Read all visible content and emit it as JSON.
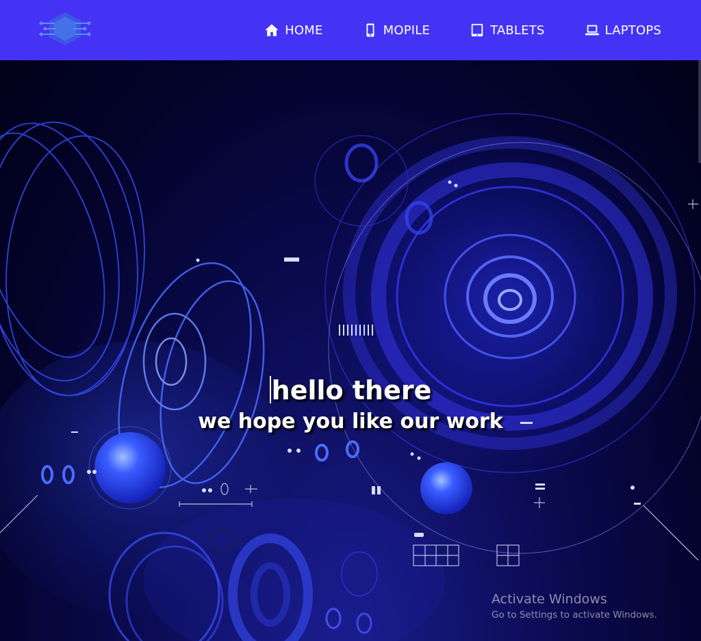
{
  "navbar": {
    "logo": {
      "icon": "circuit-hexagon-logo-icon"
    },
    "links": [
      {
        "label": "HOME",
        "icon": "home-icon"
      },
      {
        "label": "MOPILE",
        "icon": "mobile-phone-icon"
      },
      {
        "label": "TABLETS",
        "icon": "tablet-icon"
      },
      {
        "label": "LAPTOPS",
        "icon": "laptop-icon"
      }
    ],
    "background": "#4433f5"
  },
  "hero": {
    "title": "hello there",
    "subtitle": "we hope you like our work",
    "background_image": "abstract-blue-rings-tech-icon"
  },
  "watermark": {
    "title": "Activate Windows",
    "subtitle": "Go to Settings to activate Windows."
  },
  "colors": {
    "accent": "#4433f5",
    "text": "#ffffff"
  }
}
